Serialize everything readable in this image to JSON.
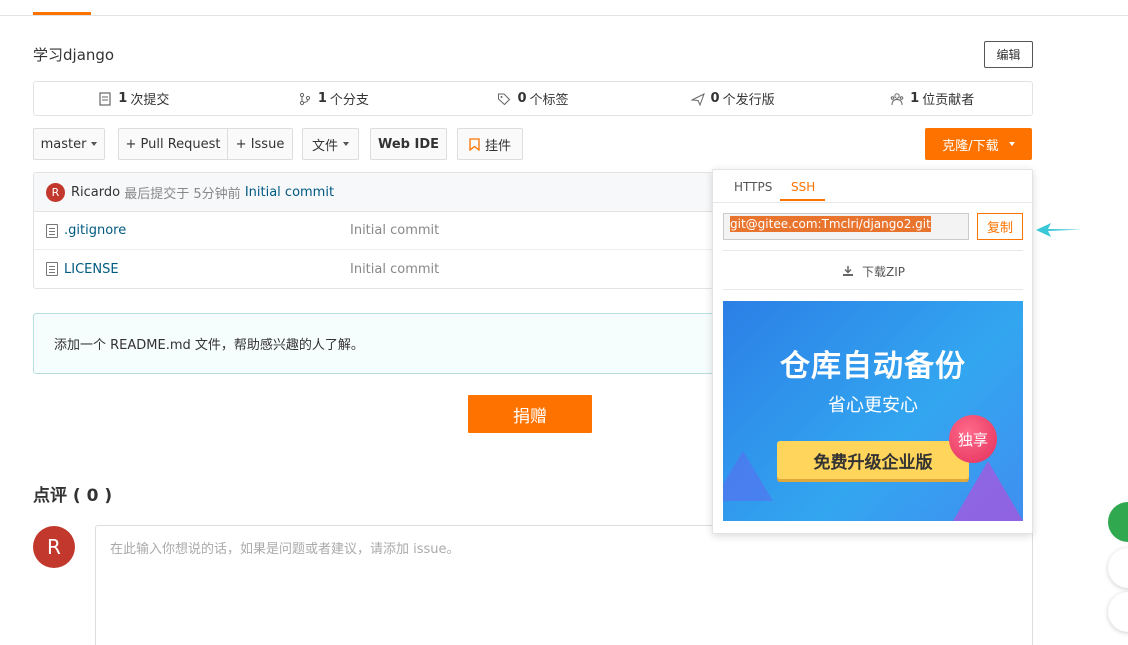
{
  "repo": {
    "description": "学习django",
    "edit_label": "编辑"
  },
  "stats": [
    {
      "icon": "commit-icon",
      "count": "1",
      "label": "次提交"
    },
    {
      "icon": "branch-icon",
      "count": "1",
      "label": "个分支"
    },
    {
      "icon": "tag-icon",
      "count": "0",
      "label": "个标签"
    },
    {
      "icon": "release-icon",
      "count": "0",
      "label": "个发行版"
    },
    {
      "icon": "contributors-icon",
      "count": "1",
      "label": "位贡献者"
    }
  ],
  "toolbar": {
    "branch": "master",
    "pull_request": "+ Pull Request",
    "issue": "+ Issue",
    "files": "文件",
    "web_ide": "Web IDE",
    "widget": "挂件",
    "clone": "克隆/下载"
  },
  "last_commit": {
    "avatar_letter": "R",
    "author": "Ricardo",
    "text": "最后提交于",
    "time": "5分钟前",
    "message": "Initial commit"
  },
  "files": [
    {
      "name": ".gitignore",
      "message": "Initial commit"
    },
    {
      "name": "LICENSE",
      "message": "Initial commit"
    }
  ],
  "readme_hint": "添加一个 README.md 文件，帮助感兴趣的人了解。",
  "donate_label": "捐赠",
  "comments": {
    "title": "点评 ( 0 )",
    "avatar_letter": "R",
    "placeholder": "在此输入你想说的话，如果是问题或者建议，请添加 issue。"
  },
  "clone_panel": {
    "tab_https": "HTTPS",
    "tab_ssh": "SSH",
    "url": "git@gitee.com:Tmclri/django2.git",
    "copy_label": "复制",
    "zip_label": "下载ZIP",
    "ad": {
      "title": "仓库自动备份",
      "subtitle": "省心更安心",
      "button": "免费升级企业版",
      "badge": "独享"
    }
  },
  "colors": {
    "accent": "#fe7300",
    "link": "#005980",
    "avatar": "#c2382c"
  }
}
